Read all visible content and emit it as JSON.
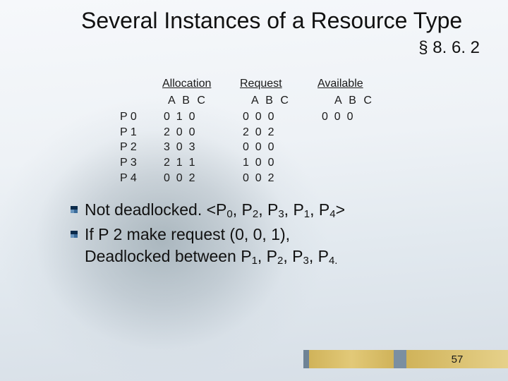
{
  "title": "Several Instances of a Resource Type",
  "section": "§ 8. 6. 2",
  "table": {
    "headers": [
      "Allocation",
      "Request",
      "Available"
    ],
    "subhead": "A B C",
    "processes": [
      "P 0",
      "P 1",
      "P 2",
      "P 3",
      "P 4"
    ],
    "allocation": [
      "0  1  0",
      "2  0  0",
      "3  0  3",
      "2  1  1",
      "0  0  2"
    ],
    "request": [
      "0  0  0",
      "2  0  2",
      "0  0  0",
      "1  0  0",
      "0  0  2"
    ],
    "available": [
      "0  0  0"
    ]
  },
  "bullets": {
    "b1_prefix": "Not deadlocked. <P",
    "b1_seq": [
      "0",
      "2",
      "3",
      "1",
      "4"
    ],
    "b1_suffix": ">",
    "b2_line1": "If P 2 make request (0, 0, 1),",
    "b2_line2_prefix": "Deadlocked between P",
    "b2_seq": [
      "1",
      "2",
      "3",
      "4."
    ]
  },
  "page_number": "57"
}
